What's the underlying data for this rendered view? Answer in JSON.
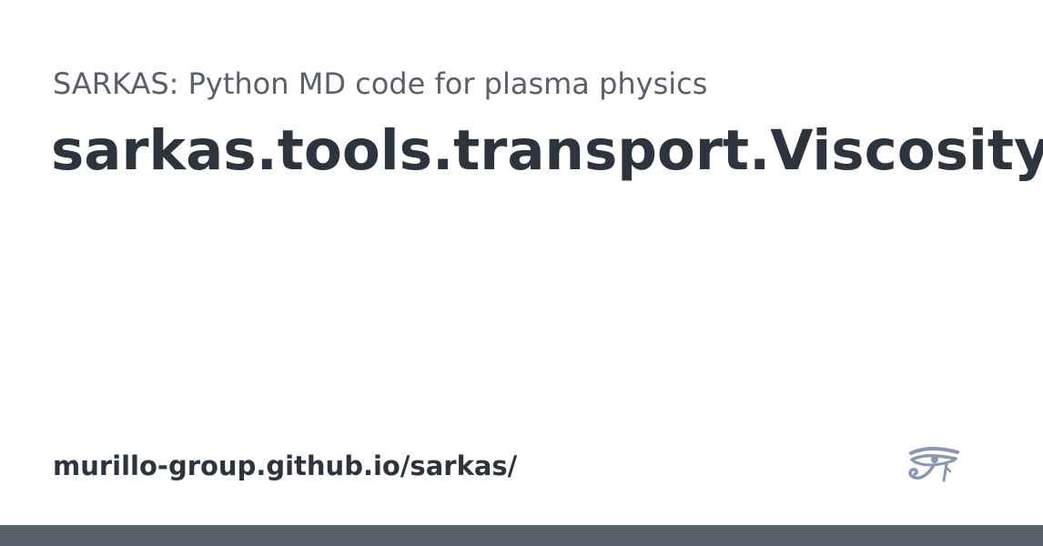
{
  "header": {
    "subtitle": "SARKAS: Python MD code for plasma physics",
    "title": "sarkas.tools.transport.Viscosity"
  },
  "footer": {
    "url": "murillo-group.github.io/sarkas/",
    "logo_icon": "eye-of-horus-icon",
    "bar_color": "#5b616c"
  },
  "colors": {
    "text_dark": "#2e343d",
    "text_muted": "#5a5f69",
    "logo": "#8a97b2"
  }
}
